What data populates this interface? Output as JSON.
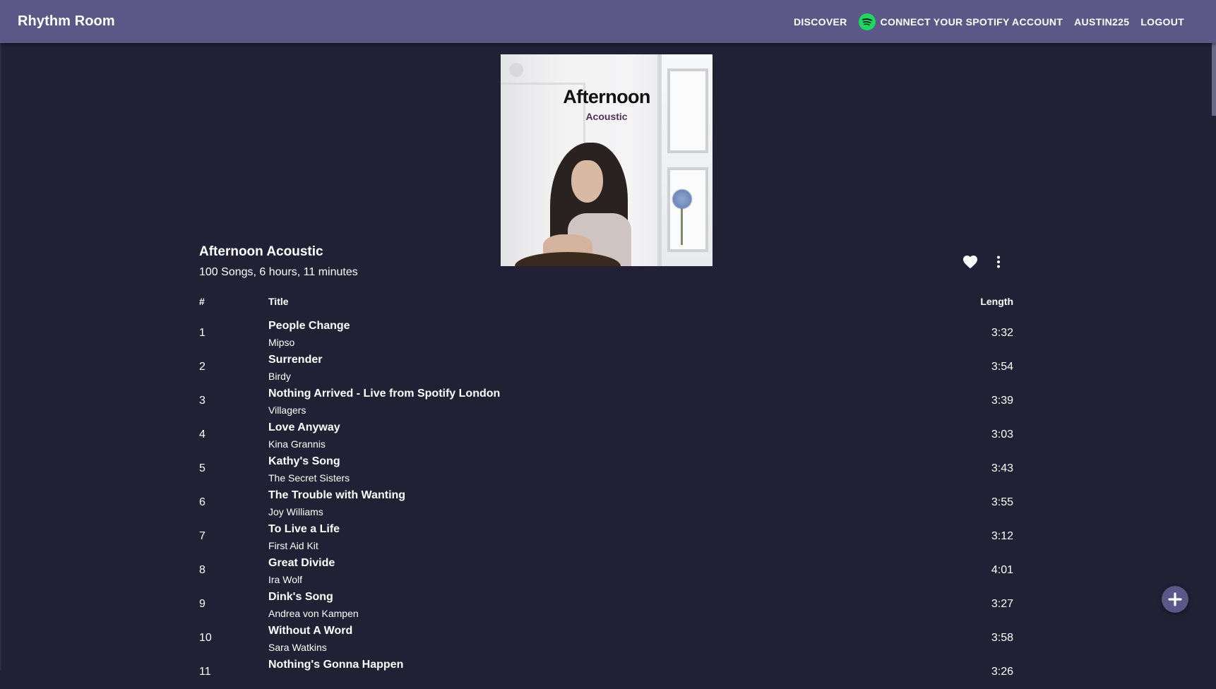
{
  "header": {
    "brand": "Rhythm Room",
    "nav": {
      "discover": "DISCOVER",
      "connect_spotify": "CONNECT YOUR SPOTIFY ACCOUNT",
      "username": "AUSTIN225",
      "logout": "LOGOUT"
    }
  },
  "colors": {
    "appbar": "#5b5786",
    "background": "#222035",
    "spotify_green": "#1ed760"
  },
  "cover": {
    "title": "Afternoon",
    "subtitle": "Acoustic"
  },
  "playlist": {
    "title": "Afternoon Acoustic",
    "meta": "100 Songs, 6 hours, 11 minutes",
    "actions": [
      "heart-icon",
      "more-vert-icon"
    ]
  },
  "table": {
    "headers": {
      "num": "#",
      "title": "Title",
      "length": "Length"
    },
    "rows": [
      {
        "num": "1",
        "title": "People Change",
        "artist": "Mipso",
        "length": "3:32"
      },
      {
        "num": "2",
        "title": "Surrender",
        "artist": "Birdy",
        "length": "3:54"
      },
      {
        "num": "3",
        "title": "Nothing Arrived - Live from Spotify London",
        "artist": "Villagers",
        "length": "3:39"
      },
      {
        "num": "4",
        "title": "Love Anyway",
        "artist": "Kina Grannis",
        "length": "3:03"
      },
      {
        "num": "5",
        "title": "Kathy's Song",
        "artist": "The Secret Sisters",
        "length": "3:43"
      },
      {
        "num": "6",
        "title": "The Trouble with Wanting",
        "artist": "Joy Williams",
        "length": "3:55"
      },
      {
        "num": "7",
        "title": "To Live a Life",
        "artist": "First Aid Kit",
        "length": "3:12"
      },
      {
        "num": "8",
        "title": "Great Divide",
        "artist": "Ira Wolf",
        "length": "4:01"
      },
      {
        "num": "9",
        "title": "Dink's Song",
        "artist": "Andrea von Kampen",
        "length": "3:27"
      },
      {
        "num": "10",
        "title": "Without A Word",
        "artist": "Sara Watkins",
        "length": "3:58"
      },
      {
        "num": "11",
        "title": "Nothing's Gonna Happen",
        "artist": "",
        "length": "3:26"
      }
    ]
  },
  "fab": {
    "icon": "plus-icon"
  }
}
